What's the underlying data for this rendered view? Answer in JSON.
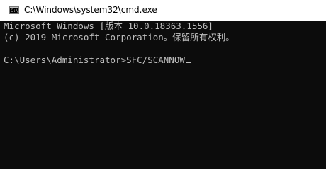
{
  "window": {
    "title": "C:\\Windows\\system32\\cmd.exe",
    "icon": "command-prompt-icon"
  },
  "console": {
    "lines": [
      "Microsoft Windows [版本 10.0.18363.1556]",
      "(c) 2019 Microsoft Corporation。保留所有权利。"
    ],
    "prompt": "C:\\Users\\Administrator>",
    "input": "SFC/SCANNOW"
  },
  "colors": {
    "console_background": "#0c0c0c",
    "console_text": "#c0c0c0",
    "titlebar_background": "#ffffff"
  }
}
